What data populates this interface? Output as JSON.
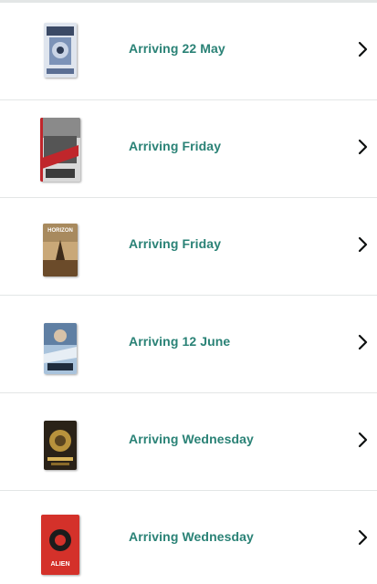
{
  "orders": [
    {
      "status": "Arriving 22 May",
      "cover": "blue-steelbook-cover",
      "icon": "chevron-right-icon"
    },
    {
      "status": "Arriving Friday",
      "cover": "red-grey-action-cover",
      "icon": "chevron-right-icon"
    },
    {
      "status": "Arriving Friday",
      "cover": "horizon-western-cover",
      "icon": "chevron-right-icon"
    },
    {
      "status": "Arriving 12 June",
      "cover": "blue-action-cover",
      "icon": "chevron-right-icon"
    },
    {
      "status": "Arriving Wednesday",
      "cover": "gold-dark-cover",
      "icon": "chevron-right-icon"
    },
    {
      "status": "Arriving Wednesday",
      "cover": "alien-red-cover",
      "icon": "chevron-right-icon"
    }
  ],
  "covers": {
    "horizon_title": "HORIZON",
    "alien_title": "ALIEN"
  },
  "colors": {
    "status_text": "#2a8276",
    "divider": "#e3e6e6",
    "chevron": "#0f1111"
  }
}
